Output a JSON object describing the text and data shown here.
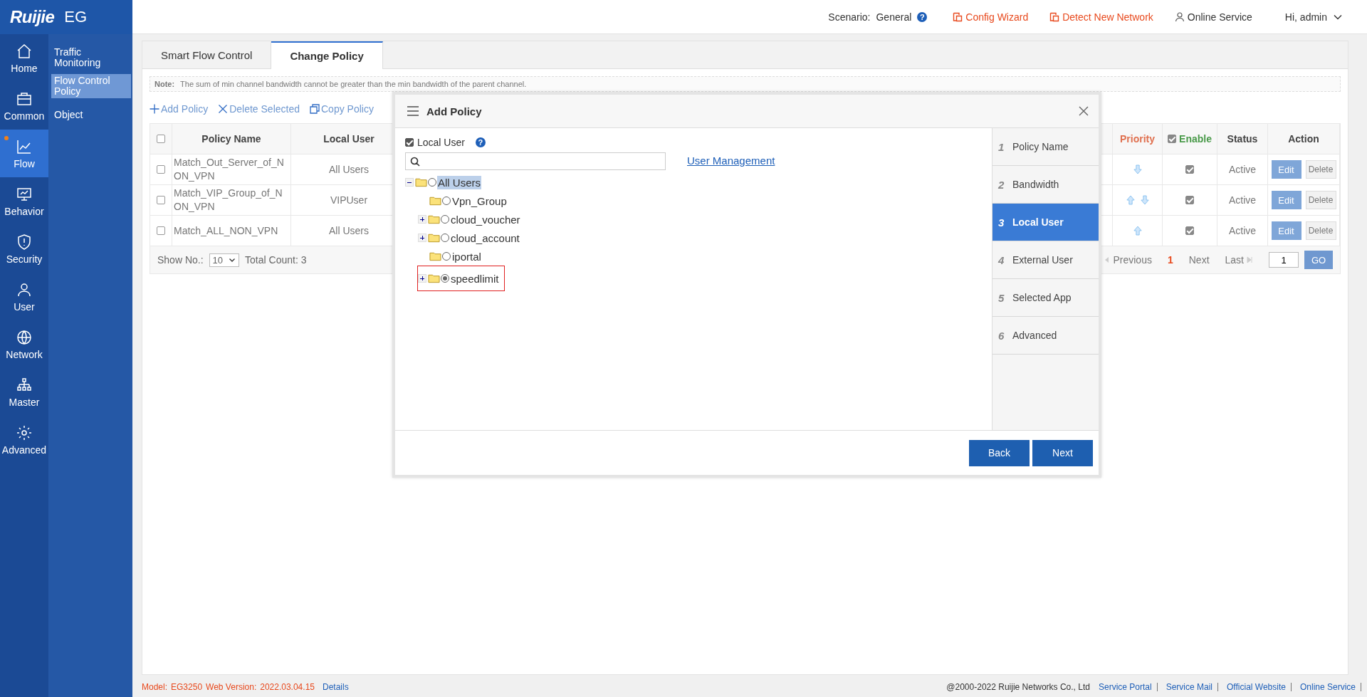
{
  "header": {
    "logo": "Ruijie",
    "product": "EG",
    "scenario_label": "Scenario:",
    "scenario": "General",
    "help": "?",
    "links": [
      "Config Wizard",
      "Detect New Network"
    ],
    "service": "Online Service",
    "user": "Hi, admin"
  },
  "nav": [
    {
      "label": "Home",
      "selected": false,
      "notify": false
    },
    {
      "label": "Common",
      "selected": false,
      "notify": false
    },
    {
      "label": "Flow",
      "selected": true,
      "notify": true
    },
    {
      "label": "Behavior",
      "selected": false,
      "notify": false
    },
    {
      "label": "Security",
      "selected": false,
      "notify": false
    },
    {
      "label": "User",
      "selected": false,
      "notify": false
    },
    {
      "label": "Network",
      "selected": false,
      "notify": false
    },
    {
      "label": "Master",
      "selected": false,
      "notify": false
    },
    {
      "label": "Advanced",
      "selected": false,
      "notify": false
    }
  ],
  "subnav": [
    {
      "label": "Traffic Monitoring",
      "selected": false
    },
    {
      "label": "Flow Control Policy",
      "selected": true
    },
    {
      "label": "Object",
      "selected": false
    }
  ],
  "tabs": [
    {
      "label": "Smart Flow Control",
      "selected": false
    },
    {
      "label": "Change Policy",
      "selected": true
    }
  ],
  "note": {
    "label": "Note:",
    "text": "The sum of min channel bandwidth cannot be greater than the min bandwidth of the parent channel."
  },
  "toolbar": [
    "Add Policy",
    "Delete Selected",
    "Copy Policy"
  ],
  "table": {
    "all_checked": false,
    "enable_all": true,
    "columns": [
      "Policy Name",
      "Local User",
      "Priority",
      "Enable",
      "Status",
      "Action"
    ],
    "rows": [
      {
        "checked": false,
        "name": "Match_Out_Server_of_NON_VPN",
        "local_user": "All Users",
        "up": false,
        "down": true,
        "enabled": true,
        "status": "Active",
        "edit": "Edit",
        "delete": "Delete"
      },
      {
        "checked": false,
        "name": "Match_VIP_Group_of_NON_VPN",
        "local_user": "VIPUser",
        "up": true,
        "down": true,
        "enabled": true,
        "status": "Active",
        "edit": "Edit",
        "delete": "Delete"
      },
      {
        "checked": false,
        "name": "Match_ALL_NON_VPN",
        "local_user": "All Users",
        "up": true,
        "down": false,
        "enabled": true,
        "status": "Active",
        "edit": "Edit",
        "delete": "Delete"
      }
    ]
  },
  "pager": {
    "show_label": "Show No.:",
    "page_size": "10",
    "total": "Total Count: 3",
    "previous": "Previous",
    "page": "1",
    "next": "Next",
    "last": "Last",
    "go_value": "1",
    "go": "GO"
  },
  "dialog": {
    "title": "Add Policy",
    "local_user": {
      "label": "Local User",
      "checked": true,
      "help": "?"
    },
    "link": "User Management",
    "tree": [
      {
        "label": "All Users",
        "expanded": true,
        "selected": false,
        "highlighted": true,
        "marked": false,
        "children": [
          {
            "label": "Vpn_Group",
            "selected": false,
            "highlighted": false,
            "marked": false
          },
          {
            "label": "cloud_voucher",
            "expanded": false,
            "selected": false,
            "highlighted": false,
            "marked": false
          },
          {
            "label": "cloud_account",
            "expanded": false,
            "selected": false,
            "highlighted": false,
            "marked": false
          },
          {
            "label": "iportal",
            "selected": false,
            "highlighted": false,
            "marked": false
          },
          {
            "label": "speedlimit",
            "expanded": false,
            "selected": true,
            "highlighted": false,
            "marked": true
          }
        ]
      }
    ],
    "steps": [
      {
        "number": "1",
        "label": "Policy Name",
        "selected": false
      },
      {
        "number": "2",
        "label": "Bandwidth",
        "selected": false
      },
      {
        "number": "3",
        "label": "Local User",
        "selected": true
      },
      {
        "number": "4",
        "label": "External User",
        "selected": false
      },
      {
        "number": "5",
        "label": "Selected App",
        "selected": false
      },
      {
        "number": "6",
        "label": "Advanced",
        "selected": false
      }
    ],
    "buttons": [
      "Back",
      "Next"
    ]
  },
  "footer": {
    "model_label": "Model:",
    "model": "EG3250",
    "version_label": "Web Version:",
    "version": "2022.03.04.15",
    "details": "Details",
    "copyright": "@2000-2022 Ruijie Networks Co., Ltd",
    "links": [
      "Service Portal",
      "Service Mail",
      "Official Website",
      "Online Service"
    ]
  }
}
